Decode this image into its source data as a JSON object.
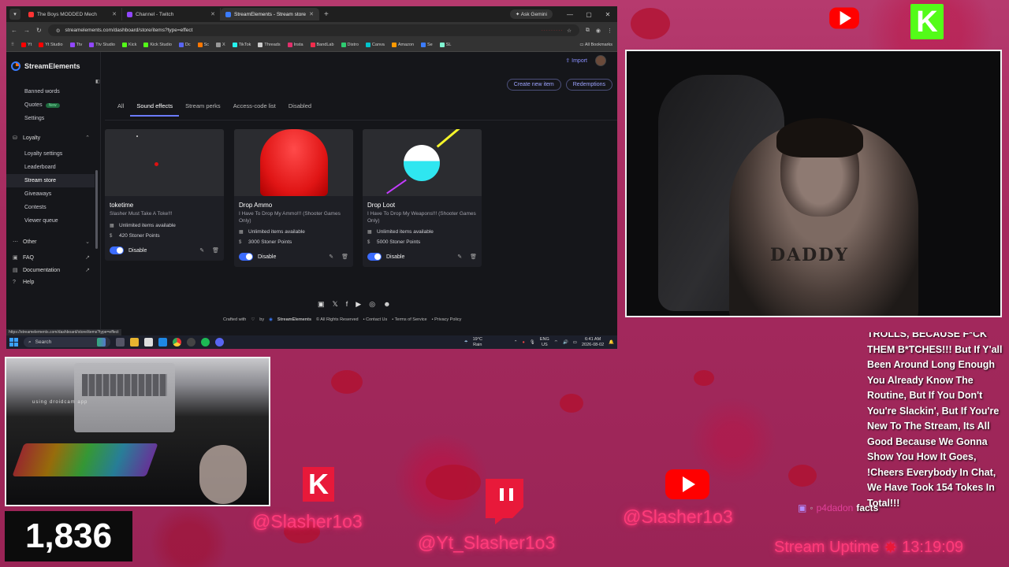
{
  "browser": {
    "tabs": [
      {
        "label": "The Boys MODDED Mech",
        "color": "#ff3333"
      },
      {
        "label": "Channel - Twitch",
        "color": "#9147ff"
      },
      {
        "label": "StreamElements - Stream store",
        "color": "#3b7cff"
      }
    ],
    "ask_label": "Ask Gemini",
    "url": "streamelements.com/dashboard/store/items?type=effect",
    "bookmarks": [
      {
        "label": "Yt",
        "color": "#ff0000"
      },
      {
        "label": "Yt Studio",
        "color": "#ff0000"
      },
      {
        "label": "Ttv",
        "color": "#9147ff"
      },
      {
        "label": "Ttv Studio",
        "color": "#9147ff"
      },
      {
        "label": "Kick",
        "color": "#53fc18"
      },
      {
        "label": "Kick Studio",
        "color": "#53fc18"
      },
      {
        "label": "Dc",
        "color": "#5865f2"
      },
      {
        "label": "Sc",
        "color": "#ff7700"
      },
      {
        "label": "X",
        "color": "#999999"
      },
      {
        "label": "TikTok",
        "color": "#25f4ee"
      },
      {
        "label": "Threads",
        "color": "#cccccc"
      },
      {
        "label": "Insta",
        "color": "#e1306c"
      },
      {
        "label": "BandLab",
        "color": "#f12c4c"
      },
      {
        "label": "Distro",
        "color": "#2ecc71"
      },
      {
        "label": "Canva",
        "color": "#00c4cc"
      },
      {
        "label": "Amazon",
        "color": "#ff9900"
      },
      {
        "label": "Se",
        "color": "#3b7cff"
      },
      {
        "label": "SL",
        "color": "#80f5d2"
      }
    ],
    "all_bookmarks": "All Bookmarks",
    "status_url": "https://streamelements.com/dashboard/store/items?type=effect"
  },
  "app": {
    "logo": "StreamElements",
    "import_label": "Import",
    "sidebar": {
      "items_top": [
        "Banned words",
        "Quotes",
        "Settings"
      ],
      "new_badge": "New",
      "loyalty": "Loyalty",
      "loyalty_items": [
        "Loyalty settings",
        "Leaderboard",
        "Stream store",
        "Giveaways",
        "Contests",
        "Viewer queue"
      ],
      "other": "Other",
      "faq": "FAQ",
      "documentation": "Documentation",
      "help": "Help"
    },
    "actions": {
      "create": "Create new item",
      "redemptions": "Redemptions"
    },
    "tabs": [
      "All",
      "Sound effects",
      "Stream perks",
      "Access-code list",
      "Disabled"
    ],
    "items": [
      {
        "title": "toketime",
        "desc": "Slasher Must Take A Toke!!!",
        "availability": "Unlimited items available",
        "cost": "420 Stoner Points",
        "toggle": "Disable"
      },
      {
        "title": "Drop Ammo",
        "desc": "I Have To Drop My Ammo!!! (Shooter Games Only)",
        "availability": "Unlimited items available",
        "cost": "3000 Stoner Points",
        "toggle": "Disable"
      },
      {
        "title": "Drop Loot",
        "desc": "I Have To Drop My Weapons!!! (Shooter Games Only)",
        "availability": "Unlimited items available",
        "cost": "5000 Stoner Points",
        "toggle": "Disable"
      }
    ],
    "footer": {
      "crafted": "Crafted with",
      "by": "by",
      "brand": "StreamElements",
      "rights": "© All Rights Reserved",
      "contact": "Contact Us",
      "terms": "Terms of Service",
      "privacy": "Privacy Policy"
    }
  },
  "taskbar": {
    "search": "Search",
    "weather_temp": "19°C",
    "weather_desc": "Rain",
    "lang1": "ENG",
    "lang2": "US",
    "time": "6:41 AM",
    "date": "2026-08-02"
  },
  "overlay": {
    "droidcam": "using droidcam app",
    "viewer_count": "1,836",
    "handle_kick": "@Slasher1o3",
    "handle_twitch": "@Yt_Slasher1o3",
    "handle_youtube": "@Slasher1o3",
    "chat_text": "TROLLS, BECAUSE F*CK THEM B*TCHES!!! But If Y'all Been Around Long Enough You Already Know The Routine, But If You Don't You're Slackin', But If You're New To The Stream, Its All Good Because We Gonna Show You How It Goes, !Cheers Everybody In Chat, We Have Took 154 Tokes In Total!!!",
    "chat_user": "p4dadon",
    "chat_message": "facts",
    "uptime_label": "Stream Uptime",
    "uptime_value": "13:19:09",
    "tattoo": "DADDY"
  }
}
